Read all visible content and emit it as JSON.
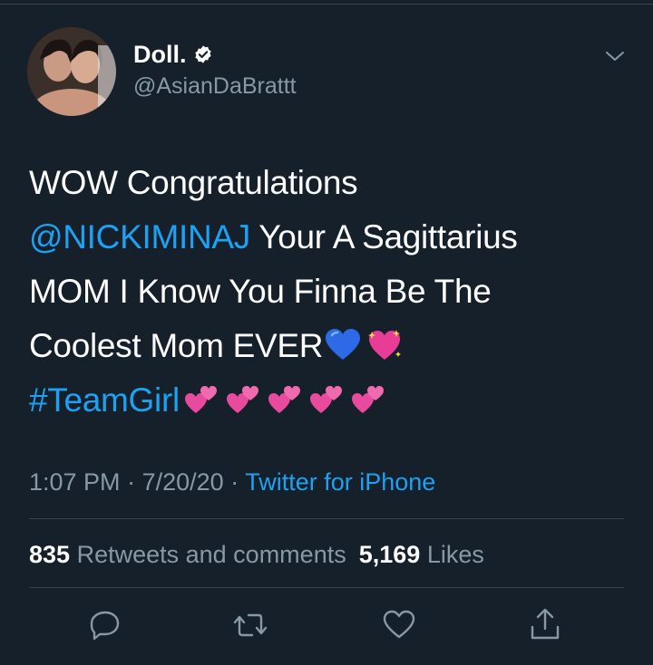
{
  "user": {
    "display_name": "Doll.",
    "handle": "@AsianDaBrattt",
    "verified": true,
    "avatar_icon": "avatar-photo",
    "verified_icon": "verified-badge-icon"
  },
  "tweet": {
    "line1": "WOW Congratulations",
    "mention": "@NICKIMINAJ",
    "line2_rest": " Your A Sagittarius",
    "line3": "MOM I Know You Finna Be The",
    "line4": "Coolest Mom EVER",
    "hashtag": "#TeamGirl",
    "emojis": [
      "blue-heart",
      "sparkling-heart",
      "two-hearts"
    ]
  },
  "meta": {
    "time": "1:07 PM",
    "sep": "·",
    "date": "7/20/20",
    "app": "Twitter for iPhone"
  },
  "stats": {
    "retweets_count": "835",
    "retweets_label": "Retweets and comments",
    "likes_count": "5,169",
    "likes_label": "Likes"
  },
  "actions": [
    "reply-icon",
    "retweet-icon",
    "like-icon",
    "share-icon"
  ],
  "colors": {
    "background": "#15202b",
    "accent": "#1da1f2",
    "secondary_text": "#8899a6",
    "divider": "#38444d"
  }
}
